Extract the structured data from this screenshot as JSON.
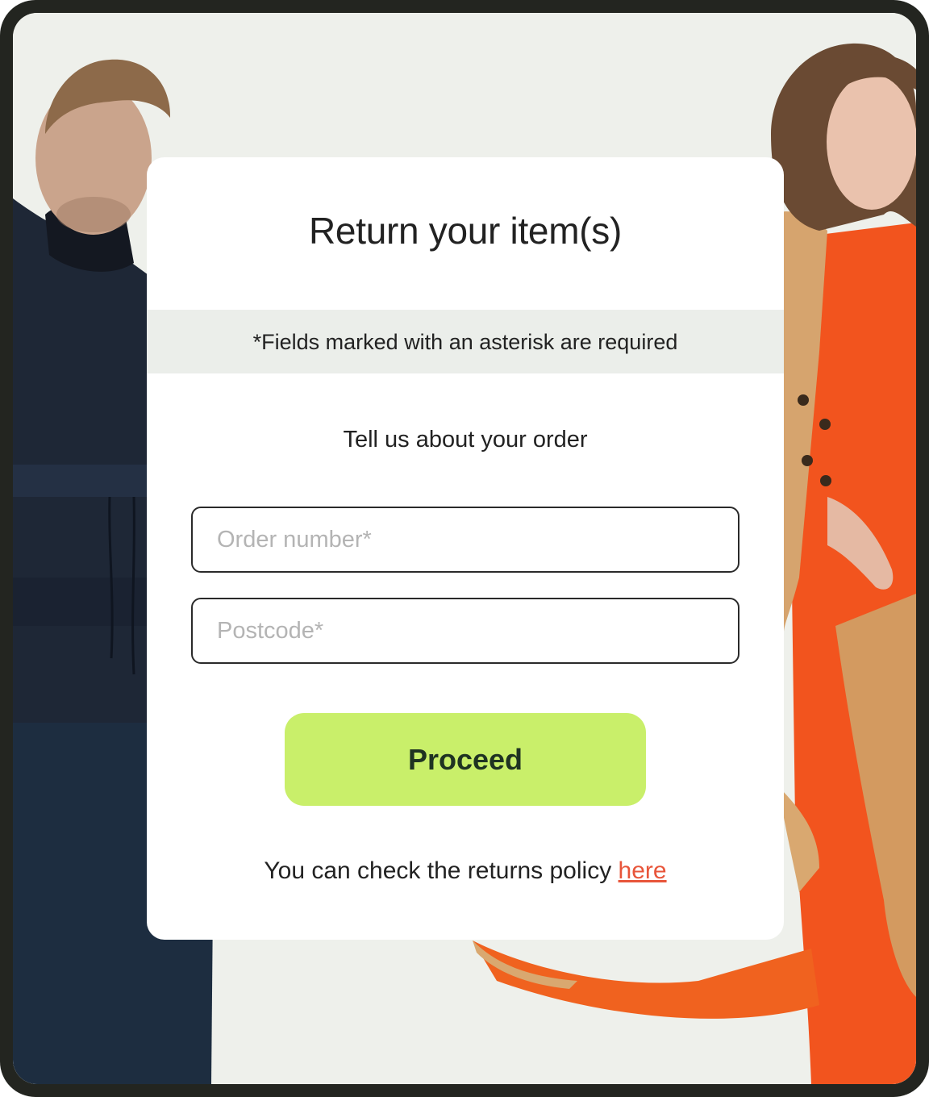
{
  "form": {
    "title": "Return your item(s)",
    "required_notice": "*Fields marked with an asterisk are required",
    "section_heading": "Tell us about your order",
    "order_number": {
      "value": "",
      "placeholder": "Order number*"
    },
    "postcode": {
      "value": "",
      "placeholder": "Postcode*"
    },
    "proceed_label": "Proceed",
    "policy_text": "You can check the returns policy ",
    "policy_link_label": "here"
  },
  "colors": {
    "frame": "#232520",
    "background": "#eef0eb",
    "card": "#ffffff",
    "notice_bar": "#ebeeea",
    "button": "#c9ef6a",
    "button_text": "#1f3322",
    "link": "#e8553a",
    "text": "#222222",
    "placeholder": "#b4b4b4"
  },
  "images": {
    "background_photo": "fashion models photo: man in navy jacket (left), woman in orange outfit and beige trench coat (right)"
  }
}
